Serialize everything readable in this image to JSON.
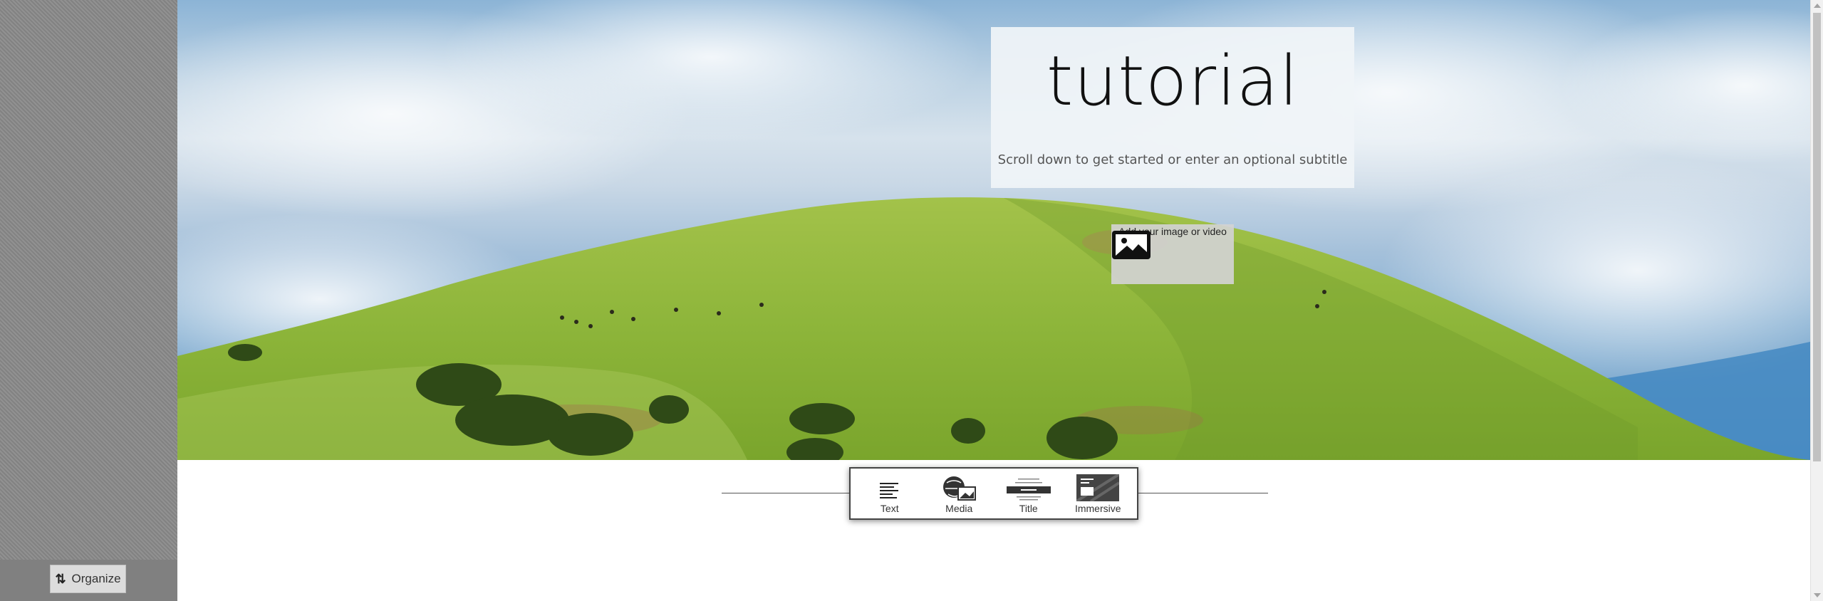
{
  "story": {
    "title": "tutorial",
    "subtitle": "Scroll down to get started or enter an optional subtitle",
    "add_media_label": "Add your image or video"
  },
  "sidebar": {
    "organize_label": "Organize",
    "organize_icon": "sort-arrows-icon"
  },
  "insert_toolbar": {
    "items": [
      {
        "label": "Text",
        "icon": "text-lines-icon"
      },
      {
        "label": "Media",
        "icon": "media-globe-image-icon"
      },
      {
        "label": "Title",
        "icon": "title-block-icon"
      },
      {
        "label": "Immersive",
        "icon": "immersive-panel-icon"
      }
    ]
  },
  "colors": {
    "sidebar": "#8a8a8a",
    "title_card": "#f0f4f8",
    "toolbar_border": "#444444",
    "grass": "#8fb83a"
  }
}
